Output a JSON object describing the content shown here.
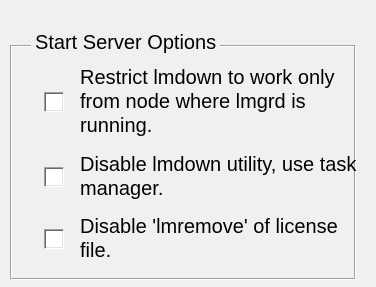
{
  "group": {
    "title": "Start Server Options"
  },
  "options": [
    {
      "label": "Restrict lmdown to work only from node where lmgrd is running.",
      "checked": false
    },
    {
      "label": "Disable lmdown utility, use task manager.",
      "checked": false
    },
    {
      "label": "Disable 'lmremove' of license file.",
      "checked": false
    }
  ]
}
